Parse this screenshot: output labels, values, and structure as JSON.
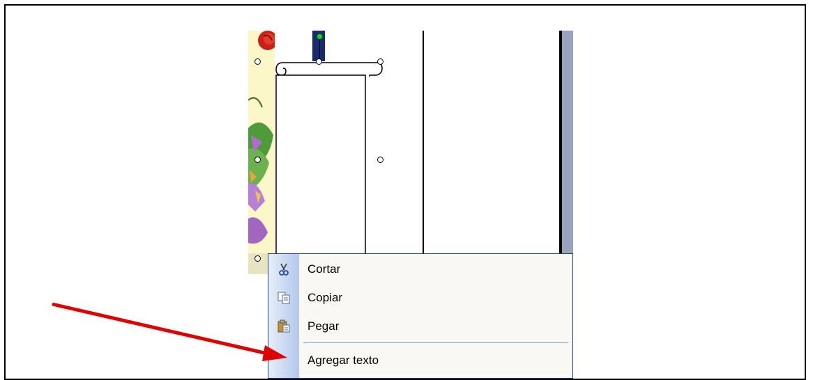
{
  "context_menu": {
    "items": [
      {
        "label": "Cortar",
        "icon": "scissors-icon"
      },
      {
        "label": "Copiar",
        "icon": "copy-icon"
      },
      {
        "label": "Pegar",
        "icon": "paste-icon"
      },
      {
        "label": "Agregar texto",
        "icon": ""
      }
    ]
  },
  "colors": {
    "annotation_arrow": "#e00000",
    "menu_border": "#1e3e8c",
    "selection_handle_rotate": "#22cc22"
  }
}
